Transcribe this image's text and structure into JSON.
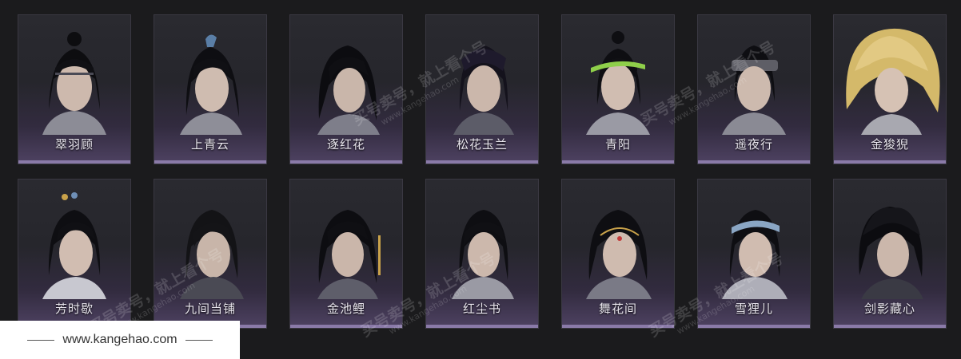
{
  "characters": [
    {
      "name": "翠羽顾"
    },
    {
      "name": "上青云"
    },
    {
      "name": "逐红花"
    },
    {
      "name": "松花玉兰"
    },
    {
      "name": "青阳"
    },
    {
      "name": "遥夜行"
    },
    {
      "name": "金狻猊"
    },
    {
      "name": "芳时歇"
    },
    {
      "name": "九间当铺"
    },
    {
      "name": "金池鲤"
    },
    {
      "name": "红尘书"
    },
    {
      "name": "舞花间"
    },
    {
      "name": "雪狸儿"
    },
    {
      "name": "剑影藏心"
    }
  ],
  "watermark": {
    "text": "买号卖号，就上看个号",
    "url": "www.kangehao.com"
  },
  "footer": {
    "url": "www.kangehao.com"
  },
  "colors": {
    "background": "#1b1b1d",
    "card_accent": "#8a7aa8",
    "name_text": "#e9e6ee"
  }
}
